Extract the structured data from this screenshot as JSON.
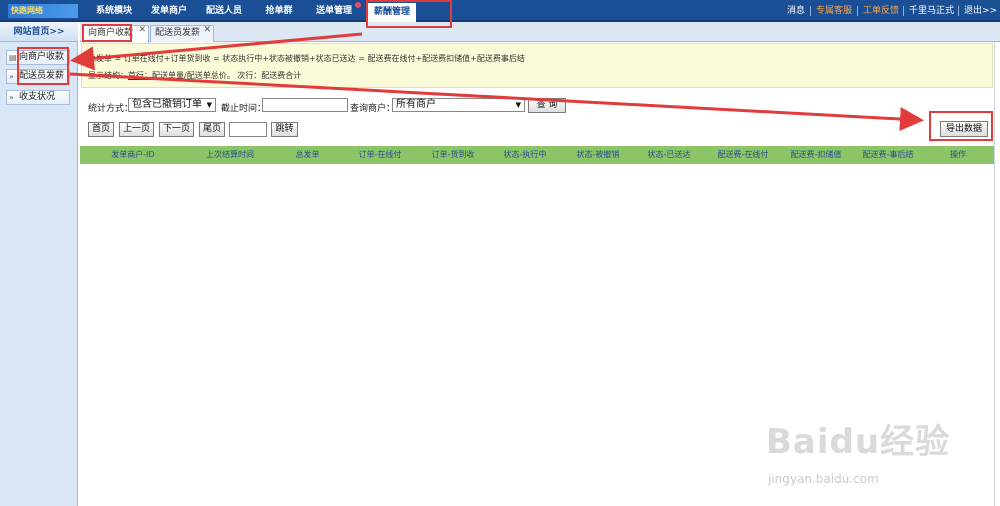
{
  "app": {
    "logo_text": "快跑网络"
  },
  "nav": {
    "items": [
      "系统模块",
      "发单商户",
      "配送人员",
      "抢单群",
      "送单管理",
      "薪酬管理"
    ],
    "active": "薪酬管理",
    "right_links": [
      "消息",
      "专属客服",
      "工单反馈",
      "千里马正式",
      "退出>>"
    ]
  },
  "sidebar": {
    "title": "网站首页>>",
    "items": [
      "向商户收款",
      "配送员发薪",
      "收支状况"
    ]
  },
  "tabs": [
    {
      "label": "向商户收款"
    },
    {
      "label": "配送员发薪"
    }
  ],
  "notice": {
    "formula": "总发单 = 订单在线付+订单货到收 = 状态执行中+状态被撤销+状态已送达 = 配送费在线付+配送费扣储值+配送费事后结",
    "structure_prefix": "显示结构：",
    "structure_main": "首行：配送单量",
    "structure_rest": "/配送单总价。  次行：配送费合计"
  },
  "filters": {
    "stat_label": "统计方式：",
    "stat_value": "包含已撤销订单",
    "end_time_label": "截止时间：",
    "end_time_value": "",
    "merchant_label": "查询商户：",
    "merchant_value": "所有商户",
    "query_button": "查 询"
  },
  "pager": {
    "first": "首页",
    "prev": "上一页",
    "next": "下一页",
    "last": "尾页",
    "page_input": "",
    "go": "跳转"
  },
  "export_button": "导出数据",
  "table": {
    "columns": [
      "发单商户-ID",
      "上次结算时间",
      "总发单",
      "订单-在线付",
      "订单-货到收",
      "状态-执行中",
      "状态-被撤销",
      "状态-已送达",
      "配送费-在线付",
      "配送费-扣储值",
      "配送费-事后结",
      "操作"
    ]
  },
  "watermark": {
    "brand": "Baidu经验",
    "url": "jingyan.baidu.com"
  },
  "colors": {
    "nav_bg": "#1a4f96",
    "header_green": "#8cc567",
    "notice_bg": "#fbfbd9",
    "annotation_red": "#e23b3b"
  }
}
